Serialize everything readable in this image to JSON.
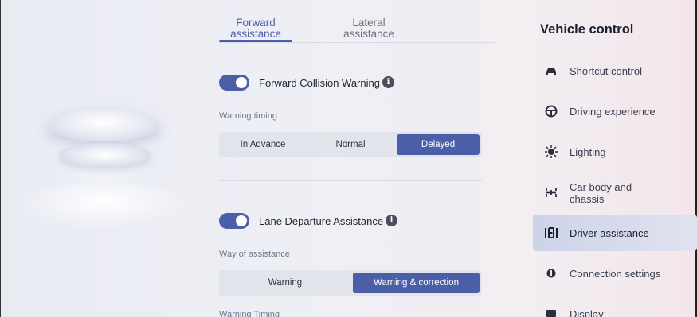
{
  "tabs": [
    {
      "label": "Forward\nassistance",
      "line1": "Forward",
      "line2": "assistance",
      "active": true
    },
    {
      "label": "Lateral\nassistance",
      "line1": "Lateral",
      "line2": "assistance",
      "active": false
    }
  ],
  "forward_collision": {
    "label": "Forward Collision Warning",
    "enabled": true,
    "info_icon": "info-icon",
    "caption": "Warning timing",
    "options": [
      "In Advance",
      "Normal",
      "Delayed"
    ],
    "selected": "Delayed"
  },
  "lane_departure": {
    "label": "Lane Departure Assistance",
    "enabled": true,
    "info_icon": "info-icon",
    "caption": "Way of assistance",
    "options": [
      "Warning",
      "Warning & correction"
    ],
    "selected": "Warning & correction",
    "next_caption": "Warning Timing"
  },
  "sidebar": {
    "title": "Vehicle control",
    "items": [
      {
        "label": "Shortcut control",
        "icon": "car-icon"
      },
      {
        "label": "Driving experience",
        "icon": "steering-wheel-icon"
      },
      {
        "label": "Lighting",
        "icon": "light-icon"
      },
      {
        "label": "Car body and chassis",
        "line1": "Car body and",
        "line2": "chassis",
        "icon": "chassis-icon"
      },
      {
        "label": "Driver assistance",
        "icon": "driver-assist-icon",
        "active": true
      },
      {
        "label": "Connection settings",
        "icon": "connection-icon"
      },
      {
        "label": "Display",
        "icon": "display-icon"
      }
    ]
  },
  "colors": {
    "accent": "#4a5fa8",
    "segment_bg": "#e2e4eb"
  }
}
